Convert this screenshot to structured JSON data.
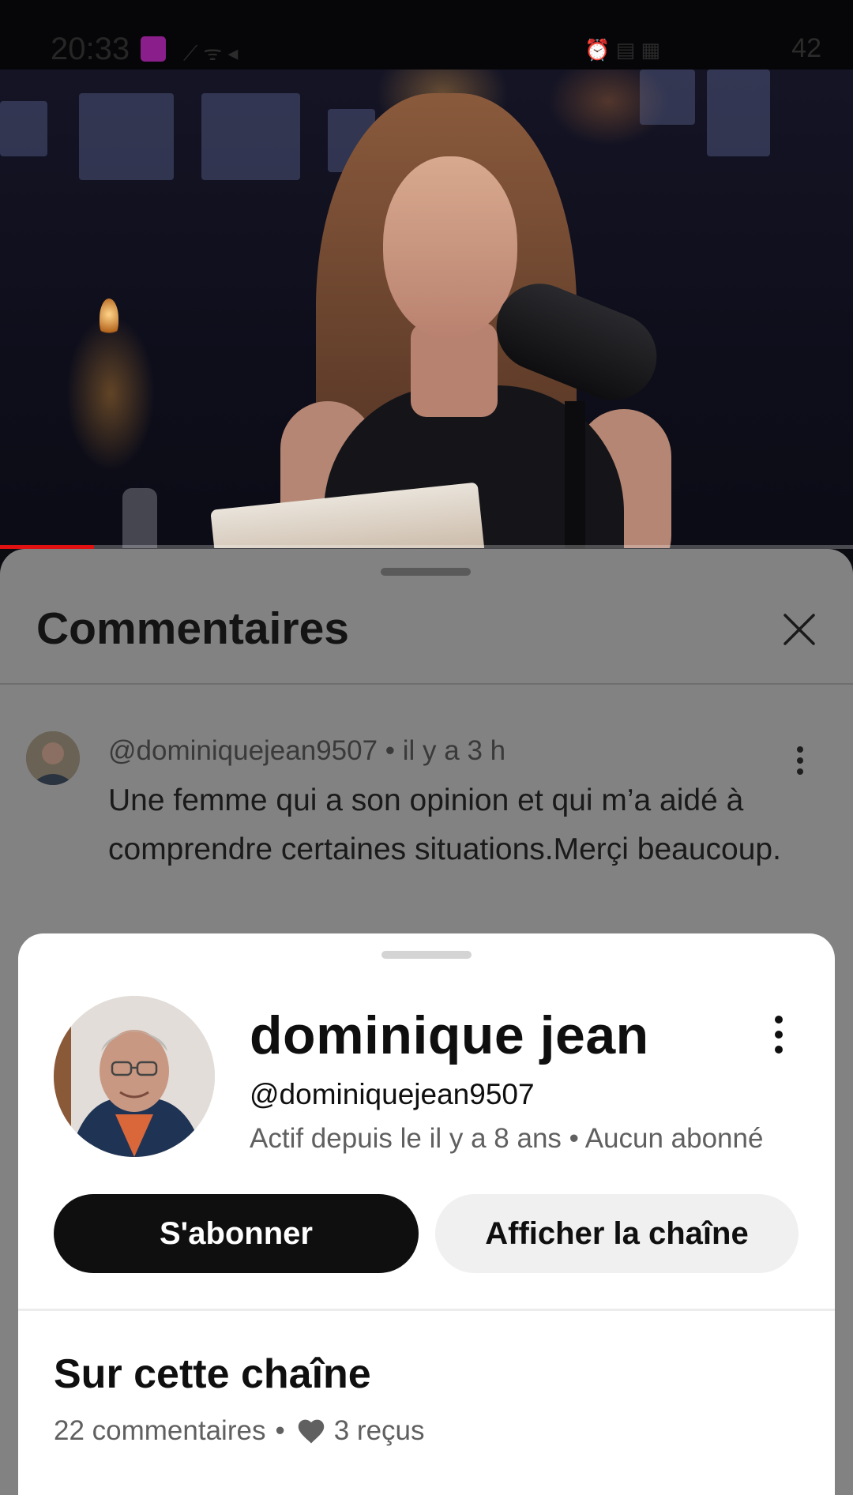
{
  "status_bar": {
    "time": "20:33",
    "battery": "42"
  },
  "video": {
    "progress": 0.11,
    "accent_color": "#e11111"
  },
  "comments": {
    "title": "Commentaires",
    "close_icon": "close-icon",
    "items": [
      {
        "author": "@dominiquejean9507",
        "time": "il y a 3 h",
        "separator": " • ",
        "text": "Une femme qui a son opinion et qui m’a aidé à comprendre certaines situations.Merçi beaucoup."
      }
    ]
  },
  "profile": {
    "name": "dominique jean",
    "handle": "@dominiquejean9507",
    "subtitle": "Actif depuis le il y a 8 ans • Aucun abonné",
    "subscribe_label": "S'abonner",
    "view_channel_label": "Afficher la chaîne",
    "section_title": "Sur cette chaîne",
    "comments_count": "22 commentaires",
    "stats_separator": "•",
    "hearts_received": "3 reçus"
  }
}
